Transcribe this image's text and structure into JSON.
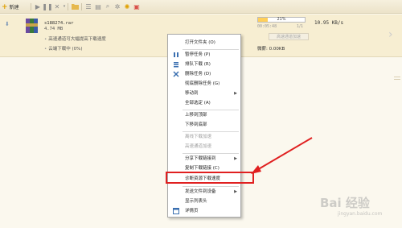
{
  "toolbar": {
    "new_label": "新建",
    "new_icon": "plus-icon",
    "icons": [
      "play-icon",
      "pause-icon",
      "delete-icon",
      "folder-icon",
      "list-icon",
      "details-icon",
      "search-icon",
      "settings-icon",
      "skin-icon",
      "gift-icon"
    ]
  },
  "task": {
    "file_name": "s188274.rar",
    "file_size": "4.74 MB",
    "hint_high_speed": "高速通道可大幅提高下载速度",
    "hint_cloud": "云端下载中 (0%)",
    "progress_text": "21%",
    "progress_value": 0.21,
    "eta": "00:05:48",
    "pieces": "1/1",
    "speed": "10.95 KB/s",
    "high_speed_button": "高速通道加速",
    "credit_label": "微薪: 0.00KB"
  },
  "context_menu": {
    "items": [
      {
        "label": "打开文件夹 (O)",
        "icon": "folder-icon",
        "disabled": false,
        "submenu": false
      },
      {
        "label": "暂停任务 (P)",
        "icon": "pause-icon",
        "disabled": false,
        "submenu": false
      },
      {
        "label": "排队下载 (R)",
        "icon": "queue-icon",
        "disabled": false,
        "submenu": false
      },
      {
        "label": "删除任务 (D)",
        "icon": "delete-icon",
        "disabled": false,
        "submenu": false
      },
      {
        "label": "彻底删除任务 (G)",
        "icon": "",
        "disabled": false,
        "submenu": false
      },
      {
        "label": "移动到",
        "icon": "",
        "disabled": false,
        "submenu": true
      },
      {
        "label": "全部选定 (A)",
        "icon": "",
        "disabled": false,
        "submenu": false
      },
      {
        "label": "上移到顶部",
        "icon": "",
        "disabled": false,
        "submenu": false
      },
      {
        "label": "下移到底部",
        "icon": "",
        "disabled": false,
        "submenu": false
      },
      {
        "label": "离线下载加速",
        "icon": "",
        "disabled": true,
        "submenu": false
      },
      {
        "label": "高速通道加速",
        "icon": "",
        "disabled": true,
        "submenu": false
      },
      {
        "label": "分享下载链接到",
        "icon": "",
        "disabled": false,
        "submenu": true
      },
      {
        "label": "复制下载链接 (C)",
        "icon": "",
        "disabled": false,
        "submenu": false
      },
      {
        "label": "诊断资源下载速度",
        "icon": "",
        "disabled": false,
        "submenu": false
      },
      {
        "label": "发送文件到设备",
        "icon": "",
        "disabled": false,
        "submenu": true
      },
      {
        "label": "显示列表头",
        "icon": "",
        "disabled": false,
        "submenu": false
      },
      {
        "label": "详情页",
        "icon": "details-page-icon",
        "disabled": false,
        "submenu": false
      }
    ]
  },
  "colors": {
    "highlight_box": "#e02020",
    "arrow": "#e02020",
    "accent": "#e0a000",
    "row_bg": "#f7eed2"
  },
  "watermark": {
    "text": "Bai 经验",
    "url": "jingyan.baidu.com"
  }
}
